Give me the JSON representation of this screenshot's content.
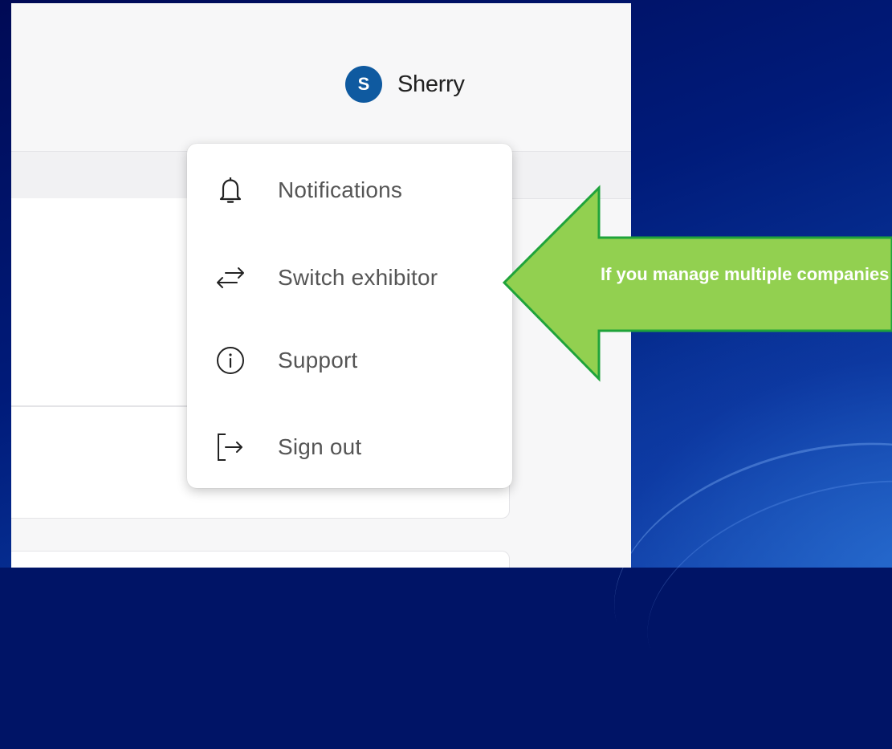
{
  "user": {
    "initial": "S",
    "name": "Sherry",
    "avatar_color": "#0f5aa0"
  },
  "menu": {
    "items": [
      {
        "label": "Notifications",
        "icon": "bell-icon"
      },
      {
        "label": "Switch exhibitor",
        "icon": "switch-arrows-icon"
      },
      {
        "label": "Support",
        "icon": "info-icon"
      },
      {
        "label": "Sign out",
        "icon": "sign-out-icon"
      }
    ]
  },
  "callout": {
    "text": "If you manage multiple companies",
    "color": "#92d050"
  },
  "background": {
    "color": "#001466"
  }
}
